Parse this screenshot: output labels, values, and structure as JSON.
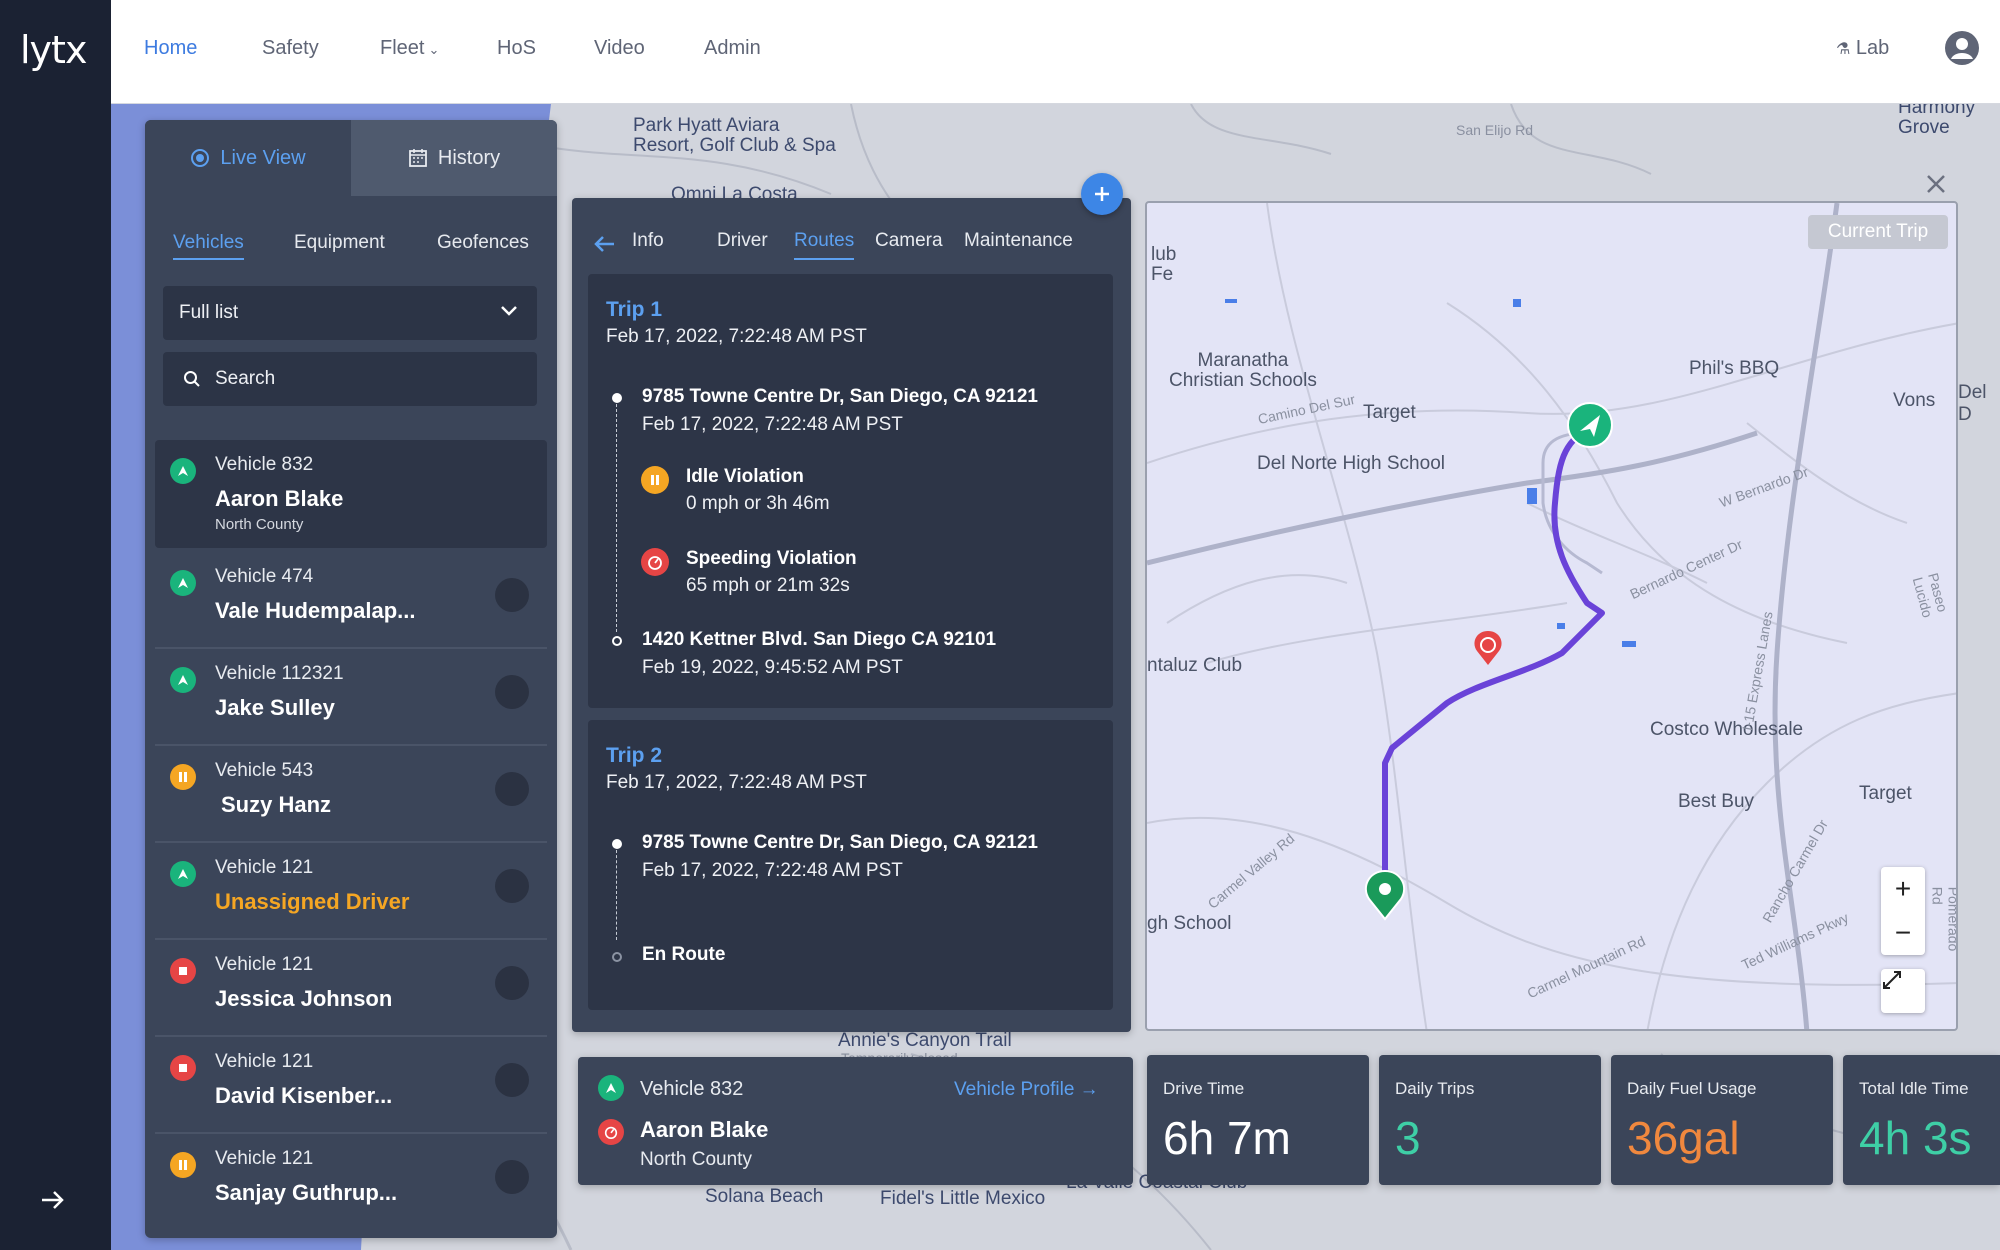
{
  "app": {
    "logo": "lytx"
  },
  "nav": {
    "items": [
      "Home",
      "Safety",
      "Fleet",
      "HoS",
      "Video",
      "Admin"
    ],
    "lab": "Lab"
  },
  "left_panel": {
    "tab_live": "Live View",
    "tab_history": "History",
    "subtabs": [
      "Vehicles",
      "Equipment",
      "Geofences"
    ],
    "list_select": "Full list",
    "search_placeholder": "Search",
    "vehicles": [
      {
        "vehicle": "Vehicle 832",
        "driver": "Aaron Blake",
        "region": "North County",
        "status": "moving"
      },
      {
        "vehicle": "Vehicle 474",
        "driver": "Vale Hudempalap...",
        "status": "moving"
      },
      {
        "vehicle": "Vehicle 112321",
        "driver": "Jake Sulley",
        "status": "moving"
      },
      {
        "vehicle": "Vehicle 543",
        "driver": "Suzy Hanz",
        "status": "idle"
      },
      {
        "vehicle": "Vehicle 121",
        "driver": "Unassigned Driver",
        "status": "moving"
      },
      {
        "vehicle": "Vehicle 121",
        "driver": "Jessica Johnson",
        "status": "stopped"
      },
      {
        "vehicle": "Vehicle 121",
        "driver": "David Kisenber...",
        "status": "stopped"
      },
      {
        "vehicle": "Vehicle 121",
        "driver": "Sanjay Guthrup...",
        "status": "idle"
      }
    ]
  },
  "trip_panel": {
    "tabs": [
      "Info",
      "Driver",
      "Routes",
      "Camera",
      "Maintenance"
    ],
    "trips": [
      {
        "title": "Trip 1",
        "date": "Feb 17, 2022, 7:22:48 AM PST",
        "start_address": "9785 Towne Centre Dr, San Diego, CA 92121",
        "start_date": "Feb 17, 2022, 7:22:48 AM PST",
        "events": [
          {
            "title": "Idle Violation",
            "detail": "0 mph or 3h 46m"
          },
          {
            "title": "Speeding Violation",
            "detail": "65 mph or 21m 32s"
          }
        ],
        "end_address": "1420 Kettner Blvd. San Diego CA 92101",
        "end_date": "Feb 19, 2022, 9:45:52 AM PST"
      },
      {
        "title": "Trip 2",
        "date": "Feb 17, 2022, 7:22:48 AM PST",
        "start_address": "9785 Towne Centre Dr, San Diego, CA 92121",
        "start_date": "Feb 17, 2022, 7:22:48 AM PST",
        "end_status": "En Route"
      }
    ]
  },
  "trip_map": {
    "badge": "Current Trip",
    "labels": {
      "phils": "Phil's BBQ",
      "vons": "Vons",
      "maranatha": "Maranatha\nChristian Schools",
      "target1": "Target",
      "delnorte": "Del Norte High School",
      "costco": "Costco Wholesale",
      "bestbuy": "Best Buy",
      "target2": "Target",
      "taluz": "ntaluz Club",
      "ghschool": "gh School",
      "lubfe": "lub\nFe",
      "bernardo": "W Bernardo Dr",
      "bernardo_ctr": "Bernardo Center Dr",
      "camino": "Camino Del Sur",
      "carmel_valley": "Carmel Valley Rd",
      "carmel_mtn": "Carmel Mountain Rd",
      "ted_williams": "Ted Williams Pkwy",
      "i15": "I-15 Express Lanes",
      "rancho": "Rancho Carmel Dr",
      "pomerado": "Pomerado Rd",
      "paseo": "Paseo Lucido",
      "del": "Del D"
    }
  },
  "background_map": {
    "labels": {
      "park_hyatt": "Park Hyatt Aviara\nResort, Golf Club & Spa",
      "omni": "Omni La Costa",
      "annies": "Annie's Canyon Trail",
      "temporarily_closed": "Temporarily closed",
      "solana": "Solana Beach",
      "fidels": "Fidel's Little Mexico",
      "la_valle": "La Valle Coastal Club",
      "harmony": "Harmony\nGrove",
      "san_elijo": "San Elijo Rd"
    }
  },
  "vehicle_card": {
    "vehicle": "Vehicle 832",
    "driver": "Aaron Blake",
    "region": "North County",
    "profile_link": "Vehicle Profile →"
  },
  "stats": [
    {
      "label": "Drive Time",
      "value": "6h 7m",
      "color": "#ffffff"
    },
    {
      "label": "Daily Trips",
      "value": "3",
      "color": "#3ecfa6"
    },
    {
      "label": "Daily Fuel Usage",
      "value": "36gal",
      "color": "#f0883e"
    },
    {
      "label": "Total Idle Time",
      "value": "4h 3s",
      "color": "#3ecfa6"
    }
  ],
  "colors": {
    "accent": "#5ca0f0",
    "route": "#6a43d8",
    "moving": "#1ab47c",
    "idle": "#f5a623",
    "stopped": "#e64545"
  }
}
